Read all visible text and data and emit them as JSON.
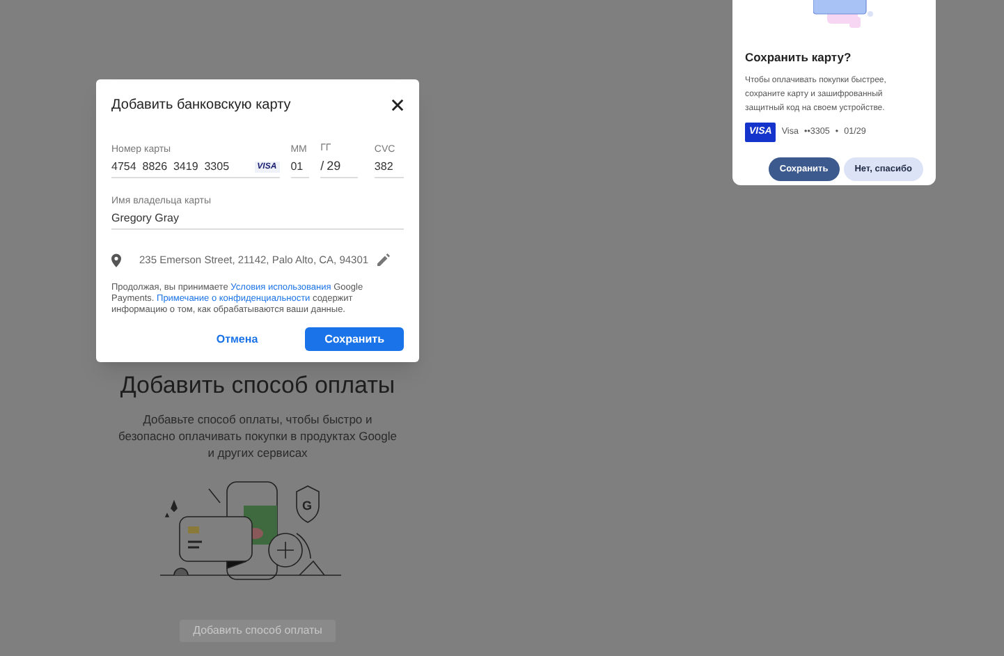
{
  "page": {
    "title": "Добавить способ оплаты",
    "description": "Добавьте способ оплаты, чтобы быстро и безопасно оплачивать покупки в продуктах Google и других сервисах",
    "button": "Добавить способ оплаты",
    "shield_letter": "G"
  },
  "dialog": {
    "title": "Добавить банковскую карту",
    "card_number": {
      "label": "Номер карты",
      "value": "4754  8826  3419  3305",
      "brand": "VISA"
    },
    "month": {
      "label": "ММ",
      "value": "01"
    },
    "separator": "/",
    "year": {
      "label": "ГГ",
      "value": "29"
    },
    "cvc": {
      "label": "CVC",
      "value": "382"
    },
    "holder": {
      "label": "Имя владельца карты",
      "value": "Gregory Gray"
    },
    "address": "235 Emerson Street, 21142, Palo Alto, CA, 94301",
    "legal": [
      {
        "kind": "text",
        "text": "Продолжая, вы принимаете "
      },
      {
        "kind": "link",
        "text": "Условия использования"
      },
      {
        "kind": "text",
        "text": " Google Payments. "
      },
      {
        "kind": "link",
        "text": "Примечание о конфиденциальности"
      },
      {
        "kind": "text",
        "text": " содержит информацию о том, как обрабатываются ваши данные."
      }
    ],
    "buttons": [
      {
        "label": "Отмена",
        "kind": "text"
      },
      {
        "label": "Сохранить",
        "kind": "filled"
      }
    ]
  },
  "popup": {
    "title": "Сохранить карту?",
    "description": "Чтобы оплачивать покупки быстрее, сохраните карту и зашифрованный защитный код на своем устройстве.",
    "brand": "VISA",
    "card_name": "Visa",
    "card_digits": "••3305",
    "dot": "•",
    "expiry": "01/29",
    "buttons": [
      {
        "label": "Сохранить",
        "kind": "filled"
      },
      {
        "label": "Нет, спасибо",
        "kind": "tonal"
      }
    ]
  }
}
